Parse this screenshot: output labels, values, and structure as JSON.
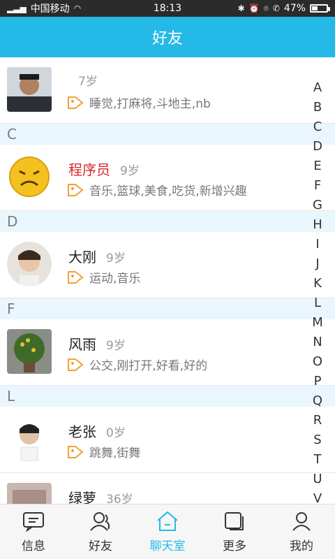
{
  "status_bar": {
    "carrier": "中国移动",
    "time": "18:13",
    "battery": "47%",
    "battery_level_percent": 47
  },
  "header": {
    "title": "好友"
  },
  "sections": [
    {
      "letter": "",
      "items": [
        {
          "name": "",
          "age": "7岁",
          "tags": "睡觉,打麻将,斗地主,nb"
        }
      ]
    },
    {
      "letter": "C",
      "items": [
        {
          "name": "程序员",
          "age": "9岁",
          "tags": "音乐,篮球,美食,吃货,新增兴趣"
        }
      ]
    },
    {
      "letter": "D",
      "items": [
        {
          "name": "大刚",
          "age": "9岁",
          "tags": "运动,音乐"
        }
      ]
    },
    {
      "letter": "F",
      "items": [
        {
          "name": "风雨",
          "age": "9岁",
          "tags": "公交,刚打开,好看,好的"
        }
      ]
    },
    {
      "letter": "L",
      "items": [
        {
          "name": "老张",
          "age": "0岁",
          "tags": "跳舞,街舞"
        },
        {
          "name": "绿萝",
          "age": "36岁",
          "tags": ""
        }
      ]
    }
  ],
  "alphabet": [
    "A",
    "B",
    "C",
    "D",
    "E",
    "F",
    "G",
    "H",
    "I",
    "J",
    "K",
    "L",
    "M",
    "N",
    "O",
    "P",
    "Q",
    "R",
    "S",
    "T",
    "U",
    "V"
  ],
  "bottom_nav": [
    {
      "label": "信息",
      "icon": "chat-icon"
    },
    {
      "label": "好友",
      "icon": "friends-icon"
    },
    {
      "label": "聊天室",
      "icon": "home-icon",
      "active": true
    },
    {
      "label": "更多",
      "icon": "more-icon"
    },
    {
      "label": "我的",
      "icon": "profile-icon"
    }
  ],
  "colors": {
    "accent": "#25b9e8",
    "section_bg": "#eaf6fd",
    "tag_icon": "#f0a235",
    "highlight_name": "#d8262b"
  }
}
